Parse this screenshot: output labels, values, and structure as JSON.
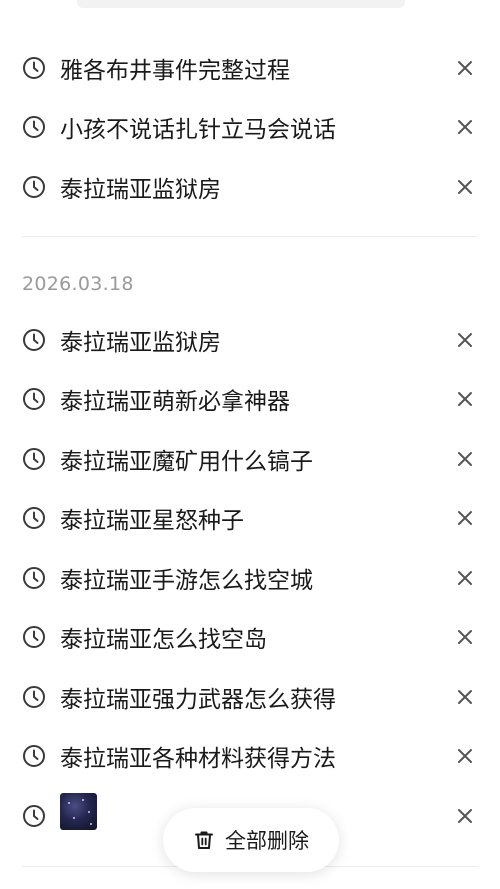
{
  "history": {
    "earlier_items": [
      "雅各布井事件完整过程",
      "小孩不说话扎针立马会说话",
      "泰拉瑞亚监狱房"
    ],
    "groups": [
      {
        "date": "2026.03.18",
        "items": [
          "泰拉瑞亚监狱房",
          "泰拉瑞亚萌新必拿神器",
          "泰拉瑞亚魔矿用什么镐子",
          "泰拉瑞亚星怒种子",
          "泰拉瑞亚手游怎么找空城",
          "泰拉瑞亚怎么找空岛",
          "泰拉瑞亚强力武器怎么获得",
          "泰拉瑞亚各种材料获得方法"
        ]
      }
    ]
  },
  "icons": {
    "history": "clock-icon",
    "remove": "close-icon",
    "delete_all": "trash-icon"
  },
  "actions": {
    "delete_all_label": "全部删除"
  }
}
